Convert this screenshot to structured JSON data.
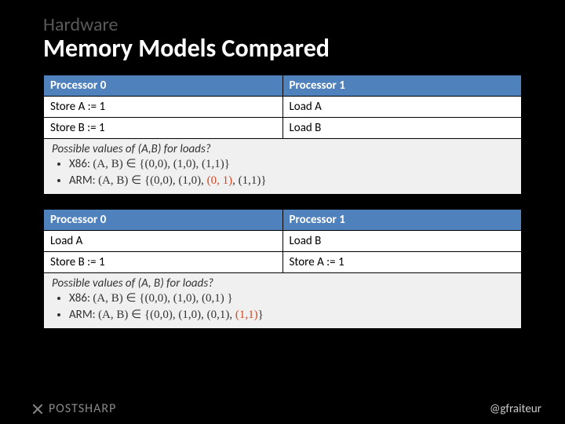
{
  "pretitle": "Hardware",
  "title": "Memory Models Compared",
  "table1": {
    "h0": "Processor 0",
    "h1": "Processor 1",
    "r1c0": "Store A := 1",
    "r1c1": "Load A",
    "r2c0": "Store B := 1",
    "r2c1": "Load B"
  },
  "result1": {
    "question": "Possible values of (A,B) for loads?",
    "x86_label": "X86: ",
    "x86_expr": "(A, B) ∈ {(0,0), (1,0), (1,1)}",
    "arm_label": "ARM: ",
    "arm_expr_pre": "(A, B) ∈ {(0,0), (1,0), ",
    "arm_hl": "(0, 1)",
    "arm_expr_post": ", (1,1)}"
  },
  "table2": {
    "h0": "Processor 0",
    "h1": "Processor 1",
    "r1c0": "Load A",
    "r1c1": "Load B",
    "r2c0": "Store B := 1",
    "r2c1": "Store A := 1"
  },
  "result2": {
    "question": "Possible values of (A, B) for loads?",
    "x86_label": "X86: ",
    "x86_expr": "(A, B) ∈ {(0,0), (1,0), (0,1) }",
    "arm_label": "ARM: ",
    "arm_expr_pre": "(A, B) ∈ {(0,0), (1,0), (0,1), ",
    "arm_hl": "(1,1)",
    "arm_expr_post": "}"
  },
  "footer": {
    "brand": "POSTSHARP",
    "handle": "@gfraiteur"
  }
}
